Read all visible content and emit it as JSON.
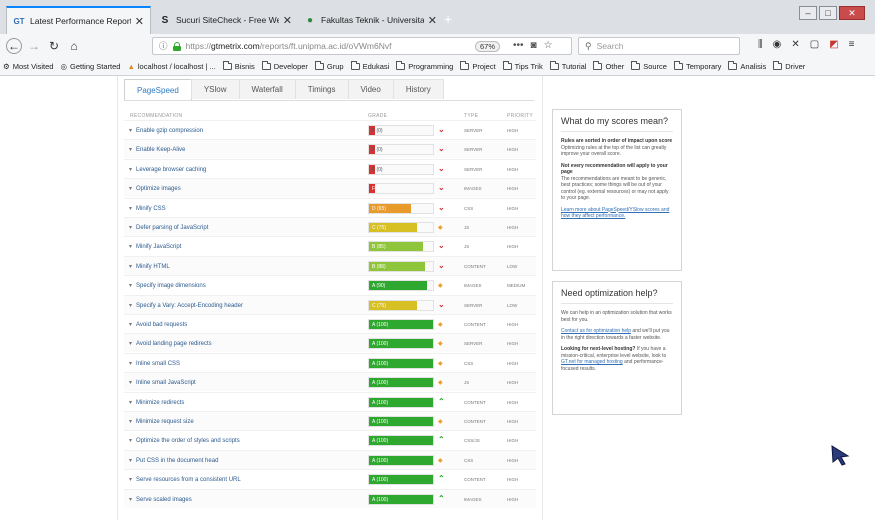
{
  "browser": {
    "tabs": [
      {
        "title": "Latest Performance Report for",
        "favicon": "GT",
        "active": true
      },
      {
        "title": "Sucuri SiteCheck - Free Websit",
        "favicon": "S",
        "active": false
      },
      {
        "title": "Fakultas Teknik - Universitas P",
        "favicon": "●",
        "active": false
      }
    ],
    "url_proto": "https://",
    "url_host": "gtmetrix.com",
    "url_path": "/reports/ft.unipma.ac.id/oVWm6Nvf",
    "zoom": "67%",
    "search_placeholder": "Search",
    "bookmarks": [
      "Most Visited",
      "Getting Started",
      "localhost / localhost | ...",
      "Bisnis",
      "Developer",
      "Grup",
      "Edukasi",
      "Programming",
      "Project",
      "Tips Trik",
      "Tutorial",
      "Other",
      "Source",
      "Temporary",
      "Analisis",
      "Driver"
    ]
  },
  "page_tabs": [
    "PageSpeed",
    "YSlow",
    "Waterfall",
    "Timings",
    "Video",
    "History"
  ],
  "columns": {
    "recommendation": "RECOMMENDATION",
    "grade": "GRADE",
    "type": "TYPE",
    "priority": "PRIORITY"
  },
  "colors": {
    "red": "#d93030",
    "orange": "#e89a2b",
    "yellow": "#d6c023",
    "lightgreen": "#8fc53a",
    "green": "#2ea82e",
    "link": "#2b5a8f"
  },
  "rows": [
    {
      "label": "Enable gzip compression",
      "grade": "F (0)",
      "score": 0,
      "color": "red",
      "trend": "down",
      "type": "SERVER",
      "priority": "HIGH"
    },
    {
      "label": "Enable Keep-Alive",
      "grade": "F (0)",
      "score": 0,
      "color": "red",
      "trend": "down",
      "type": "SERVER",
      "priority": "HIGH"
    },
    {
      "label": "Leverage browser caching",
      "grade": "F (0)",
      "score": 0,
      "color": "red",
      "trend": "down",
      "type": "SERVER",
      "priority": "HIGH"
    },
    {
      "label": "Optimize images",
      "grade": "F (6)",
      "score": 6,
      "color": "red",
      "trend": "down",
      "type": "IMAGES",
      "priority": "HIGH"
    },
    {
      "label": "Minify CSS",
      "grade": "D (65)",
      "score": 65,
      "color": "orange",
      "trend": "down",
      "type": "CSS",
      "priority": "HIGH"
    },
    {
      "label": "Defer parsing of JavaScript",
      "grade": "C (75)",
      "score": 75,
      "color": "yellow",
      "trend": "neutral",
      "type": "JS",
      "priority": "HIGH"
    },
    {
      "label": "Minify JavaScript",
      "grade": "B (85)",
      "score": 85,
      "color": "lightgreen",
      "trend": "down",
      "type": "JS",
      "priority": "HIGH"
    },
    {
      "label": "Minify HTML",
      "grade": "B (88)",
      "score": 88,
      "color": "lightgreen",
      "trend": "down",
      "type": "CONTENT",
      "priority": "LOW"
    },
    {
      "label": "Specify image dimensions",
      "grade": "A (90)",
      "score": 90,
      "color": "green",
      "trend": "neutral",
      "type": "IMAGES",
      "priority": "MEDIUM"
    },
    {
      "label": "Specify a Vary: Accept-Encoding header",
      "grade": "C (75)",
      "score": 75,
      "color": "yellow",
      "trend": "down",
      "type": "SERVER",
      "priority": "LOW"
    },
    {
      "label": "Avoid bad requests",
      "grade": "A (100)",
      "score": 100,
      "color": "green",
      "trend": "neutral",
      "type": "CONTENT",
      "priority": "HIGH"
    },
    {
      "label": "Avoid landing page redirects",
      "grade": "A (100)",
      "score": 100,
      "color": "green",
      "trend": "neutral",
      "type": "SERVER",
      "priority": "HIGH"
    },
    {
      "label": "Inline small CSS",
      "grade": "A (100)",
      "score": 100,
      "color": "green",
      "trend": "neutral",
      "type": "CSS",
      "priority": "HIGH"
    },
    {
      "label": "Inline small JavaScript",
      "grade": "A (100)",
      "score": 100,
      "color": "green",
      "trend": "neutral",
      "type": "JS",
      "priority": "HIGH"
    },
    {
      "label": "Minimize redirects",
      "grade": "A (100)",
      "score": 100,
      "color": "green",
      "trend": "up",
      "type": "CONTENT",
      "priority": "HIGH"
    },
    {
      "label": "Minimize request size",
      "grade": "A (100)",
      "score": 100,
      "color": "green",
      "trend": "neutral",
      "type": "CONTENT",
      "priority": "HIGH"
    },
    {
      "label": "Optimize the order of styles and scripts",
      "grade": "A (100)",
      "score": 100,
      "color": "green",
      "trend": "up",
      "type": "CSS/JS",
      "priority": "HIGH"
    },
    {
      "label": "Put CSS in the document head",
      "grade": "A (100)",
      "score": 100,
      "color": "green",
      "trend": "neutral",
      "type": "CSS",
      "priority": "HIGH"
    },
    {
      "label": "Serve resources from a consistent URL",
      "grade": "A (100)",
      "score": 100,
      "color": "green",
      "trend": "up",
      "type": "CONTENT",
      "priority": "HIGH"
    },
    {
      "label": "Serve scaled images",
      "grade": "A (100)",
      "score": 100,
      "color": "green",
      "trend": "up",
      "type": "IMAGES",
      "priority": "HIGH"
    }
  ],
  "sidebar": {
    "scores": {
      "title": "What do my scores mean?",
      "p1_bold": "Rules are sorted in order of impact upon score",
      "p1": "Optimizing rules at the top of the list can greatly improve your overall score.",
      "p2_bold": "Not every recommendation will apply to your page",
      "p2": "The recommendations are meant to be generic, best practices; some things will be out of your control (eg. external resources) or may not apply to your page.",
      "link": "Learn more about PageSpeed/YSlow scores and how they affect performance."
    },
    "help": {
      "title": "Need optimization help?",
      "p1": "We can help in an optimization solution that works best for you.",
      "link1": "Contact us for optimization help",
      "p2": " and we'll put you in the right direction towards a faster website.",
      "p3_bold": "Looking for next-level hosting?",
      "p3": " If you have a mission-critical, enterprise level website, look to ",
      "link2": "GT.net for managed hosting",
      "p4": " and performance-focused results."
    }
  }
}
